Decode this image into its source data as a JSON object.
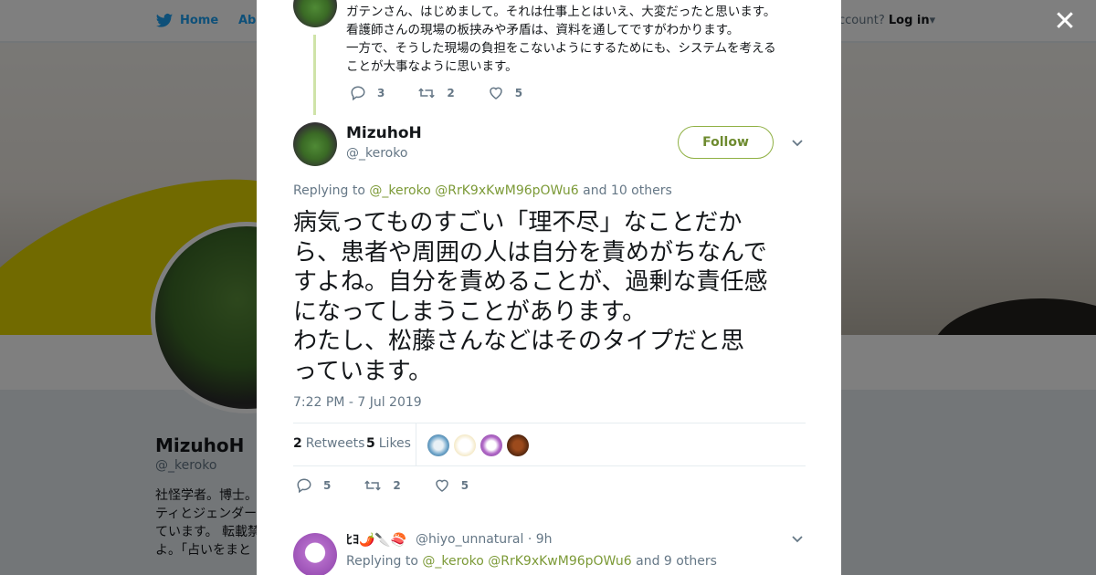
{
  "topnav": {
    "home_label": "Home",
    "about_label": "Abo",
    "account_prompt": "ccount?",
    "login_label": "Log in"
  },
  "profile": {
    "name": "MizuhoH",
    "handle": "@_keroko",
    "bio": "社怪学者。博士。\nティとジェンダー\nています。 転載禁\nよ。「占いをまと"
  },
  "previous_tweet": {
    "text": "ガテンさん、はじめまして。それは仕事上とはいえ、大変だったと思います。\n看護師さんの現場の板挟みや矛盾は、資料を通してですがわかります。\n一方で、そうした現場の負担をこないようにするためにも、システムを考える\nことが大事なように思います。",
    "replies": "3",
    "retweets": "2",
    "likes": "5"
  },
  "main_tweet": {
    "author_name": "MizuhoH",
    "author_handle": "@_keroko",
    "follow_label": "Follow",
    "replying_prefix": "Replying to",
    "replying_handles": "@_keroko @RrK9xKwM96pOWu6",
    "replying_suffix": "and 10 others",
    "text": "病気ってものすごい「理不尽」なことだか\nら、患者や周囲の人は自分を責めがちなんで\nすよね。自分を責めることが、過剰な責任感\nになってしまうことがあります。\nわたし、松藤さんなどはそのタイプだと思\nっています。",
    "timestamp": "7:22 PM - 7 Jul 2019",
    "retweets_count": "2",
    "retweets_label": "Retweets",
    "likes_count": "5",
    "likes_label": "Likes",
    "replies": "5",
    "retweets": "2",
    "likes": "5"
  },
  "reply_tweet": {
    "display_name": "ﾋﾖ🌶️🔪🍣",
    "handle": "@hiyo_unnatural",
    "time": "· 9h",
    "replying_prefix": "Replying to",
    "replying_handles": "@_keroko @RrK9xKwM96pOWu6",
    "replying_suffix": "and 9 others"
  },
  "colors": {
    "accent": "#7c9a37",
    "twitter_blue": "#1da1f2",
    "muted": "#657786"
  },
  "icons": [
    "twitter-bird-icon",
    "close-icon",
    "reply-icon",
    "retweet-icon",
    "like-icon",
    "chevron-down-icon"
  ]
}
